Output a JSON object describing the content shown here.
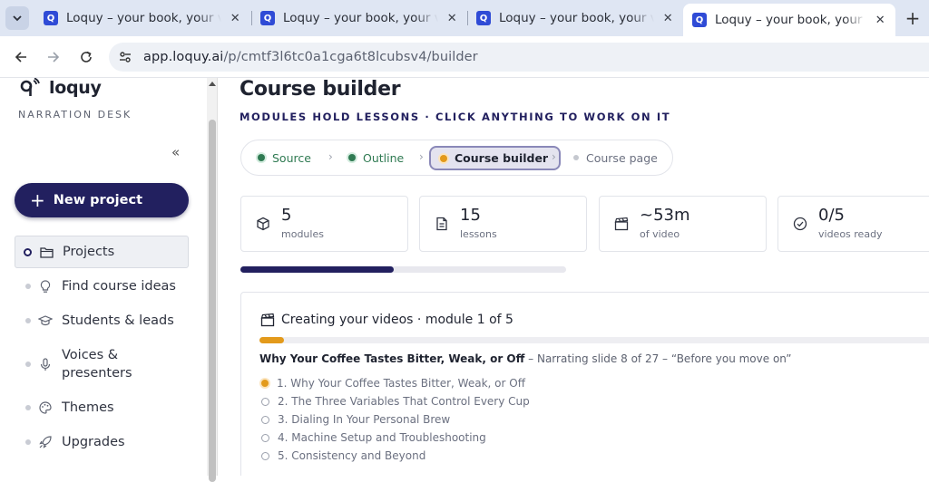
{
  "browser": {
    "tabs": [
      {
        "title": "Loquy – your book, your voice",
        "favicon": "Q",
        "active": false
      },
      {
        "title": "Loquy – your book, your voice",
        "favicon": "Q",
        "active": false
      },
      {
        "title": "Loquy – your book, your voice",
        "favicon": "Q",
        "active": false
      },
      {
        "title": "Loquy – your book, your voice",
        "favicon": "Q",
        "active": true
      }
    ],
    "url_host": "app.loquy.ai",
    "url_path": "/p/cmtf3l6tc0a1cga6t8lcubsv4/builder"
  },
  "sidebar": {
    "logo_text": "loquy",
    "subtitle": "NARRATION DESK",
    "collapse_glyph": "«",
    "new_project_plus": "+",
    "new_project_label": "New project",
    "items": [
      {
        "label": "Projects",
        "icon": "folder-icon",
        "active": true
      },
      {
        "label": "Find course ideas",
        "icon": "lightbulb-icon",
        "active": false
      },
      {
        "label": "Students & leads",
        "icon": "graduation-cap-icon",
        "active": false
      },
      {
        "label": "Voices &\npresenters",
        "icon": "microphone-icon",
        "active": false
      },
      {
        "label": "Themes",
        "icon": "palette-icon",
        "active": false
      },
      {
        "label": "Upgrades",
        "icon": "rocket-icon",
        "active": false
      }
    ]
  },
  "main": {
    "title": "Course builder",
    "subtitle": "MODULES HOLD LESSONS · CLICK ANYTHING TO WORK ON IT",
    "steps": [
      {
        "label": "Source",
        "state": "done"
      },
      {
        "label": "Outline",
        "state": "done"
      },
      {
        "label": "Course builder",
        "state": "current"
      },
      {
        "label": "Course page",
        "state": "todo"
      }
    ],
    "stats": [
      {
        "value": "5",
        "label": "modules",
        "icon": "cube-icon"
      },
      {
        "value": "15",
        "label": "lessons",
        "icon": "document-icon"
      },
      {
        "value": "~53m",
        "label": "of video",
        "icon": "clapperboard-icon"
      },
      {
        "value": "0/5",
        "label": "videos ready",
        "icon": "check-circle-icon"
      }
    ],
    "overall_progress": 0.47,
    "module_card": {
      "heading": "Creating your videos · module 1 of 5",
      "progress": 0.035,
      "current_lesson": "Why Your Coffee Tastes Bitter, Weak, or Off",
      "status_text": " – Narrating slide 8 of 27 – “Before you move on”",
      "lessons": [
        {
          "label": "1. Why Your Coffee Tastes Bitter, Weak, or Off",
          "state": "current"
        },
        {
          "label": "2. The Three Variables That Control Every Cup",
          "state": "pending"
        },
        {
          "label": "3. Dialing In Your Personal Brew",
          "state": "pending"
        },
        {
          "label": "4. Machine Setup and Troubleshooting",
          "state": "pending"
        },
        {
          "label": "5. Consistency and Beyond",
          "state": "pending"
        }
      ]
    }
  },
  "colors": {
    "brand": "#22205f",
    "done": "#2f7a52",
    "in_progress": "#e39a1b"
  }
}
